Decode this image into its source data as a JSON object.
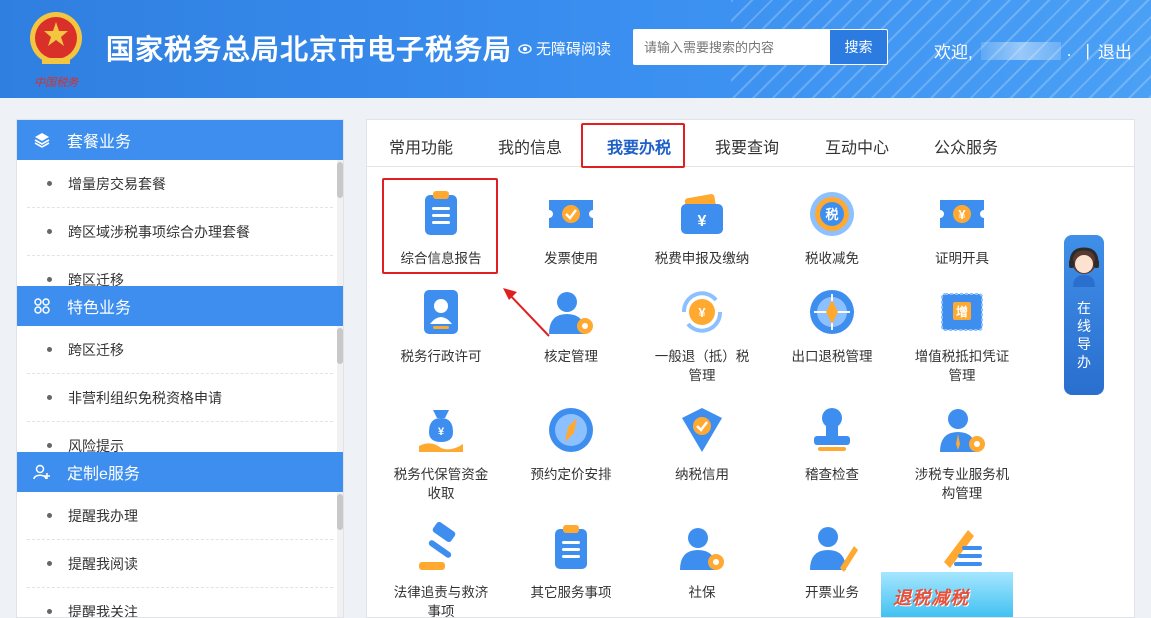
{
  "header": {
    "title": "国家税务总局北京市电子税务局",
    "accessibility": "无障碍阅读",
    "search_placeholder": "请输入需要搜索的内容",
    "search_button": "搜索",
    "welcome": "欢迎,",
    "welcome_dot": ".",
    "separator": "|",
    "logout": "退出",
    "emblem_text": "中国税务"
  },
  "sidebar": {
    "sections": [
      {
        "title": "套餐业务",
        "icon": "layers-icon",
        "items": [
          "增量房交易套餐",
          "跨区域涉税事项综合办理套餐",
          "跨区迁移"
        ]
      },
      {
        "title": "特色业务",
        "icon": "grid-icon",
        "items": [
          "跨区迁移",
          "非营利组织免税资格申请",
          "风险提示"
        ]
      },
      {
        "title": "定制e服务",
        "icon": "user-add-icon",
        "items": [
          "提醒我办理",
          "提醒我阅读",
          "提醒我关注"
        ]
      }
    ]
  },
  "tabs": [
    "常用功能",
    "我的信息",
    "我要办税",
    "我要查询",
    "互动中心",
    "公众服务"
  ],
  "active_tab": "我要办税",
  "services": [
    {
      "label": "综合信息报告",
      "icon": "clipboard-icon"
    },
    {
      "label": "发票使用",
      "icon": "ticket-check-icon"
    },
    {
      "label": "税费申报及缴纳",
      "icon": "wallet-yen-icon"
    },
    {
      "label": "税收减免",
      "icon": "tax-coin-icon"
    },
    {
      "label": "证明开具",
      "icon": "ticket-yen-icon"
    },
    {
      "label": "税务行政许可",
      "icon": "id-card-icon"
    },
    {
      "label": "核定管理",
      "icon": "user-gear-icon"
    },
    {
      "label": "一般退（抵）税管理",
      "icon": "yen-refresh-icon"
    },
    {
      "label": "出口退税管理",
      "icon": "globe-icon"
    },
    {
      "label": "增值税抵扣凭证管理",
      "icon": "vat-ticket-icon"
    },
    {
      "label": "税务代保管资金收取",
      "icon": "money-bag-icon"
    },
    {
      "label": "预约定价安排",
      "icon": "compass-icon"
    },
    {
      "label": "纳税信用",
      "icon": "shield-check-icon"
    },
    {
      "label": "稽查检查",
      "icon": "stamp-icon"
    },
    {
      "label": "涉税专业服务机构管理",
      "icon": "agent-gear-icon"
    },
    {
      "label": "法律追责与救济事项",
      "icon": "gavel-icon"
    },
    {
      "label": "其它服务事项",
      "icon": "clipboard-icon"
    },
    {
      "label": "社保",
      "icon": "user-gear-icon"
    },
    {
      "label": "开票业务",
      "icon": "user-pen-icon"
    },
    {
      "label": "",
      "icon": "pen-lines-icon"
    }
  ],
  "guide": {
    "text": "在线导办"
  },
  "promo": {
    "text": "退税减税"
  },
  "colors": {
    "brand": "#3d8eee",
    "highlight": "#e02020",
    "active_tab": "#1e5fc8"
  }
}
